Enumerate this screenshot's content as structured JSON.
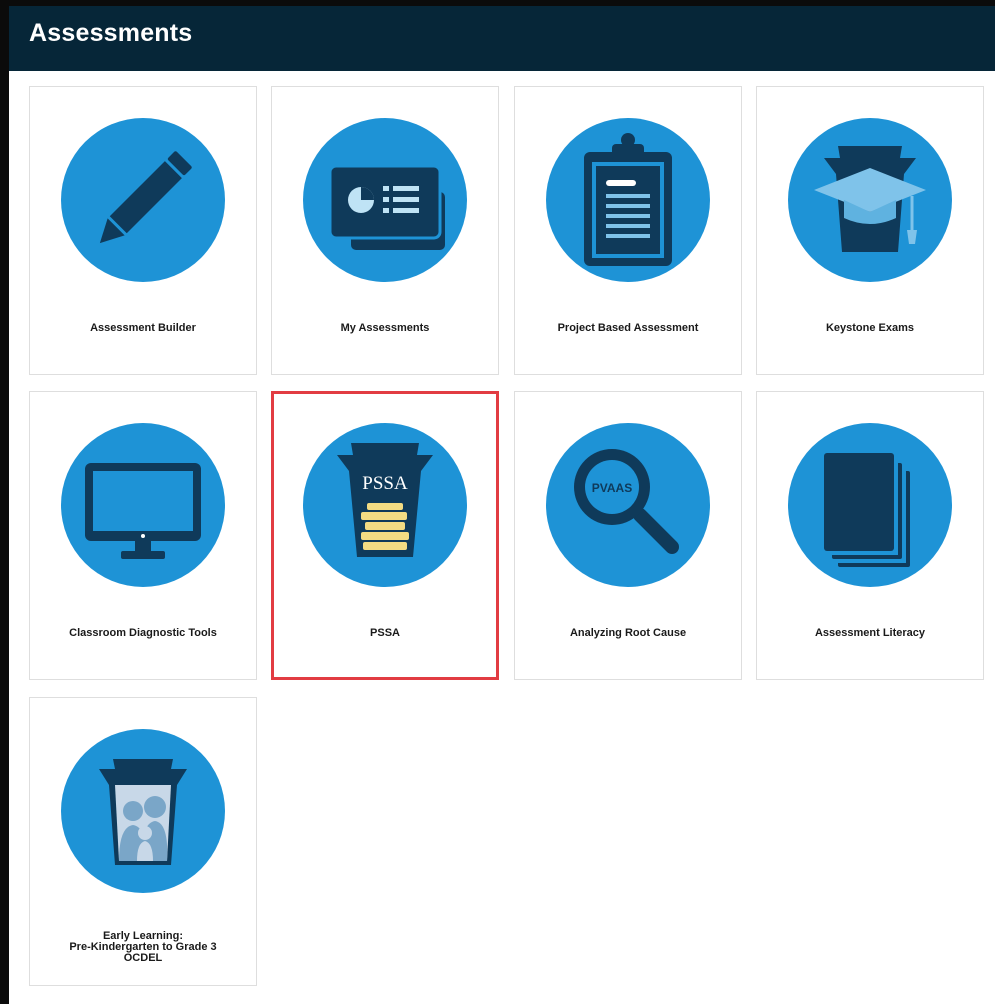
{
  "header": {
    "title": "Assessments"
  },
  "tiles": [
    {
      "label": "Assessment Builder",
      "icon": "pencil-icon"
    },
    {
      "label": "My Assessments",
      "icon": "dashboard-cards-icon"
    },
    {
      "label": "Project Based Assessment",
      "icon": "clipboard-icon"
    },
    {
      "label": "Keystone Exams",
      "icon": "keystone-graduation-cap-icon"
    },
    {
      "label": "Classroom Diagnostic Tools",
      "icon": "computer-monitor-icon"
    },
    {
      "label": "PSSA",
      "icon": "pssa-keystone-books-icon",
      "icon_text": "PSSA",
      "selected": true
    },
    {
      "label": "Analyzing Root Cause",
      "icon": "pvaas-magnifier-icon",
      "icon_text": "PVAAS"
    },
    {
      "label": "Assessment Literacy",
      "icon": "books-stack-icon"
    },
    {
      "label_lines": [
        "Early Learning:",
        "Pre-Kindergarten to Grade 3",
        "OCDEL"
      ],
      "icon": "keystone-family-icon"
    }
  ],
  "colors": {
    "header_bg": "#062638",
    "circle": "#1e93d6",
    "icon_dark": "#0f3a5a",
    "selected_border": "#e23c42",
    "books": "#f3dc83"
  }
}
